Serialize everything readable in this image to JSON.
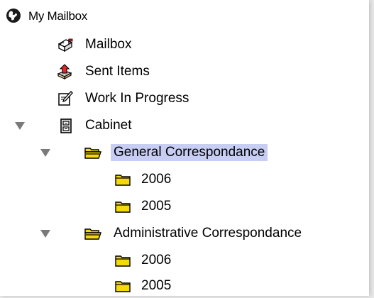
{
  "tree": {
    "root": {
      "label": "My Mailbox",
      "icon": "globe-icon"
    },
    "items": [
      {
        "label": "Mailbox",
        "icon": "mailbox-icon"
      },
      {
        "label": "Sent Items",
        "icon": "sent-items-icon"
      },
      {
        "label": "Work In Progress",
        "icon": "work-in-progress-icon"
      },
      {
        "label": "Cabinet",
        "icon": "cabinet-icon",
        "expanded": true
      },
      {
        "label": "General Correspondance",
        "icon": "folder-open-icon",
        "expanded": true,
        "selected": true
      },
      {
        "label": "2006",
        "icon": "folder-icon"
      },
      {
        "label": "2005",
        "icon": "folder-icon"
      },
      {
        "label": "Administrative Correspondance",
        "icon": "folder-open-icon",
        "expanded": true
      },
      {
        "label": "2006",
        "icon": "folder-icon"
      },
      {
        "label": "2005",
        "icon": "folder-icon"
      }
    ]
  },
  "colors": {
    "selection": "#c8cdf3",
    "folder": "#f5d90a",
    "disclosure": "#7a7a7a"
  }
}
